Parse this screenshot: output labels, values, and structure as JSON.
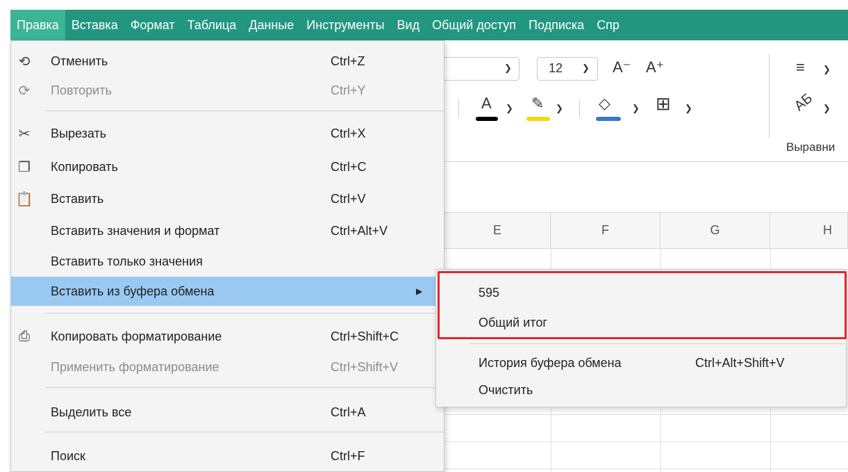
{
  "menubar": {
    "items": [
      "Правка",
      "Вставка",
      "Формат",
      "Таблица",
      "Данные",
      "Инструменты",
      "Вид",
      "Общий доступ",
      "Подписка",
      "Спр"
    ]
  },
  "ribbon": {
    "font_size": "12",
    "font_decrease": "A⁻",
    "font_increase": "A⁺",
    "align_group_label": "Выравни"
  },
  "columns": [
    "E",
    "F",
    "G",
    "H"
  ],
  "edit_menu": {
    "undo": {
      "label": "Отменить",
      "shortcut": "Ctrl+Z"
    },
    "redo": {
      "label": "Повторить",
      "shortcut": "Ctrl+Y"
    },
    "cut": {
      "label": "Вырезать",
      "shortcut": "Ctrl+X"
    },
    "copy": {
      "label": "Копировать",
      "shortcut": "Ctrl+C"
    },
    "paste": {
      "label": "Вставить",
      "shortcut": "Ctrl+V"
    },
    "paste_values_format": {
      "label": "Вставить значения и формат",
      "shortcut": "Ctrl+Alt+V"
    },
    "paste_values_only": {
      "label": "Вставить только значения"
    },
    "paste_from_clipboard": {
      "label": "Вставить из буфера обмена"
    },
    "copy_formatting": {
      "label": "Копировать форматирование",
      "shortcut": "Ctrl+Shift+C"
    },
    "apply_formatting": {
      "label": "Применить форматирование",
      "shortcut": "Ctrl+Shift+V"
    },
    "select_all": {
      "label": "Выделить все",
      "shortcut": "Ctrl+A"
    },
    "find": {
      "label": "Поиск",
      "shortcut": "Ctrl+F"
    }
  },
  "clipboard_submenu": {
    "entries": [
      "595",
      "Общий итог"
    ],
    "history": {
      "label": "История буфера обмена",
      "shortcut": "Ctrl+Alt+Shift+V"
    },
    "clear": {
      "label": "Очистить"
    }
  },
  "colors": {
    "menubar_bg": "#23967f",
    "menubar_active": "#3cb496",
    "highlight": "#99c9f1",
    "red_outline": "#e0282d",
    "font_color_swatch": "#000000",
    "highlight_swatch": "#f5d80a",
    "fill_swatch": "#3b78c3"
  }
}
